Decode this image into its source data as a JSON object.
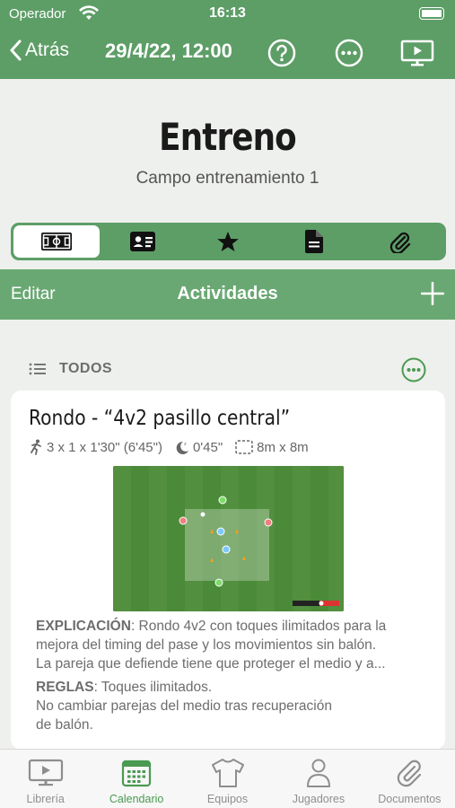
{
  "status_bar": {
    "carrier": "Operador",
    "time": "16:13"
  },
  "nav": {
    "back_label": "Atrás",
    "date": "29/4/22, 12:00"
  },
  "header": {
    "title": "Entreno",
    "subtitle": "Campo entrenamiento 1"
  },
  "segments": [
    {
      "icon": "pitch-icon",
      "active": true
    },
    {
      "icon": "id-card-icon",
      "active": false
    },
    {
      "icon": "star-icon",
      "active": false
    },
    {
      "icon": "document-icon",
      "active": false
    },
    {
      "icon": "paperclip-icon",
      "active": false
    }
  ],
  "toolbar": {
    "edit_label": "Editar",
    "title": "Actividades"
  },
  "section": {
    "label": "TODOS"
  },
  "activity": {
    "title": "Rondo - “4v2 pasillo central”",
    "series": "3 x 1 x 1'30\" (6'45\")",
    "rest": "0'45\"",
    "area": "8m x 8m",
    "explanation_label": "EXPLICACIÓN",
    "explanation_line1": ": Rondo 4v2 con toques ilimitados para la",
    "explanation_line2": "mejora del timing del pase y los movimientos sin balón.",
    "explanation_line3": "La pareja que defiende tiene que proteger el medio y a...",
    "rules_label": "REGLAS",
    "rules_line1": ": Toques ilimitados.",
    "rules_line2": "No cambiar parejas del medio tras recuperación",
    "rules_line3": "de balón."
  },
  "tabs": [
    {
      "label": "Librería",
      "icon": "play-screen-icon",
      "active": false
    },
    {
      "label": "Calendario",
      "icon": "calendar-icon",
      "active": true
    },
    {
      "label": "Equipos",
      "icon": "shirt-icon",
      "active": false
    },
    {
      "label": "Jugadores",
      "icon": "person-icon",
      "active": false
    },
    {
      "label": "Documentos",
      "icon": "paperclip-icon",
      "active": false
    }
  ],
  "colors": {
    "brand_green": "#5d9e67",
    "active_tab": "#4a9a52"
  }
}
